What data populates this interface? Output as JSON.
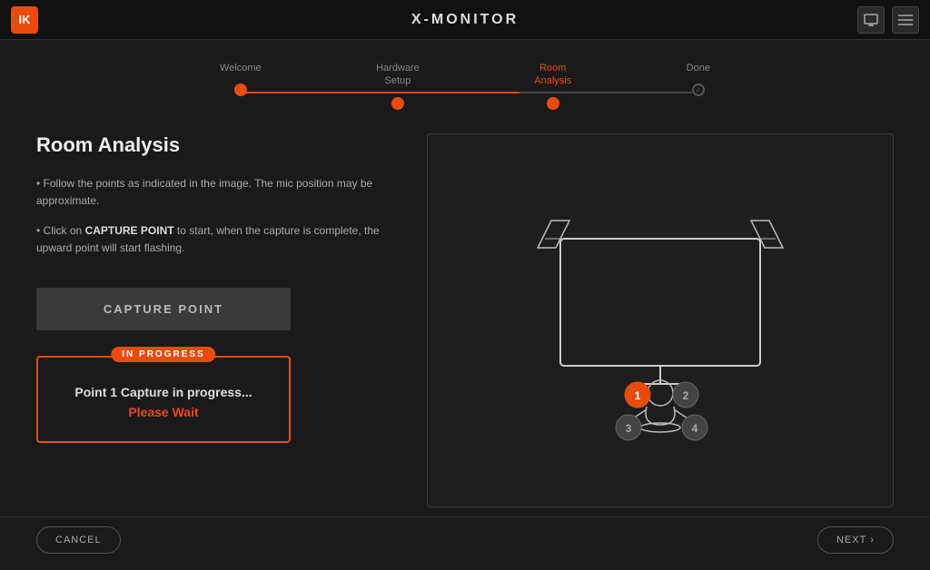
{
  "header": {
    "title": "X-MONITOR",
    "logo_text": "IK"
  },
  "stepper": {
    "steps": [
      {
        "id": "welcome",
        "label": "Welcome",
        "state": "completed"
      },
      {
        "id": "hardware-setup",
        "label": "Hardware\nSetup",
        "state": "completed"
      },
      {
        "id": "room-analysis",
        "label": "Room\nAnalysis",
        "state": "active"
      },
      {
        "id": "done",
        "label": "Done",
        "state": "inactive"
      }
    ]
  },
  "main": {
    "section_title": "Room Analysis",
    "instructions": [
      "• Follow the points as indicated in the image. The mic position may be approximate.",
      "• Click on CAPTURE POINT to start, when the capture is complete, the upward point will start flashing."
    ],
    "capture_button_label": "CAPTURE POINT",
    "progress": {
      "badge_label": "IN PROGRESS",
      "message": "Point 1 Capture in progress...",
      "wait_label": "Please Wait"
    }
  },
  "footer": {
    "cancel_label": "CANCEL",
    "next_label": "NEXT"
  },
  "diagram": {
    "points": [
      {
        "id": 1,
        "label": "1",
        "active": true
      },
      {
        "id": 2,
        "label": "2",
        "active": false
      },
      {
        "id": 3,
        "label": "3",
        "active": false
      },
      {
        "id": 4,
        "label": "4",
        "active": false
      }
    ]
  }
}
